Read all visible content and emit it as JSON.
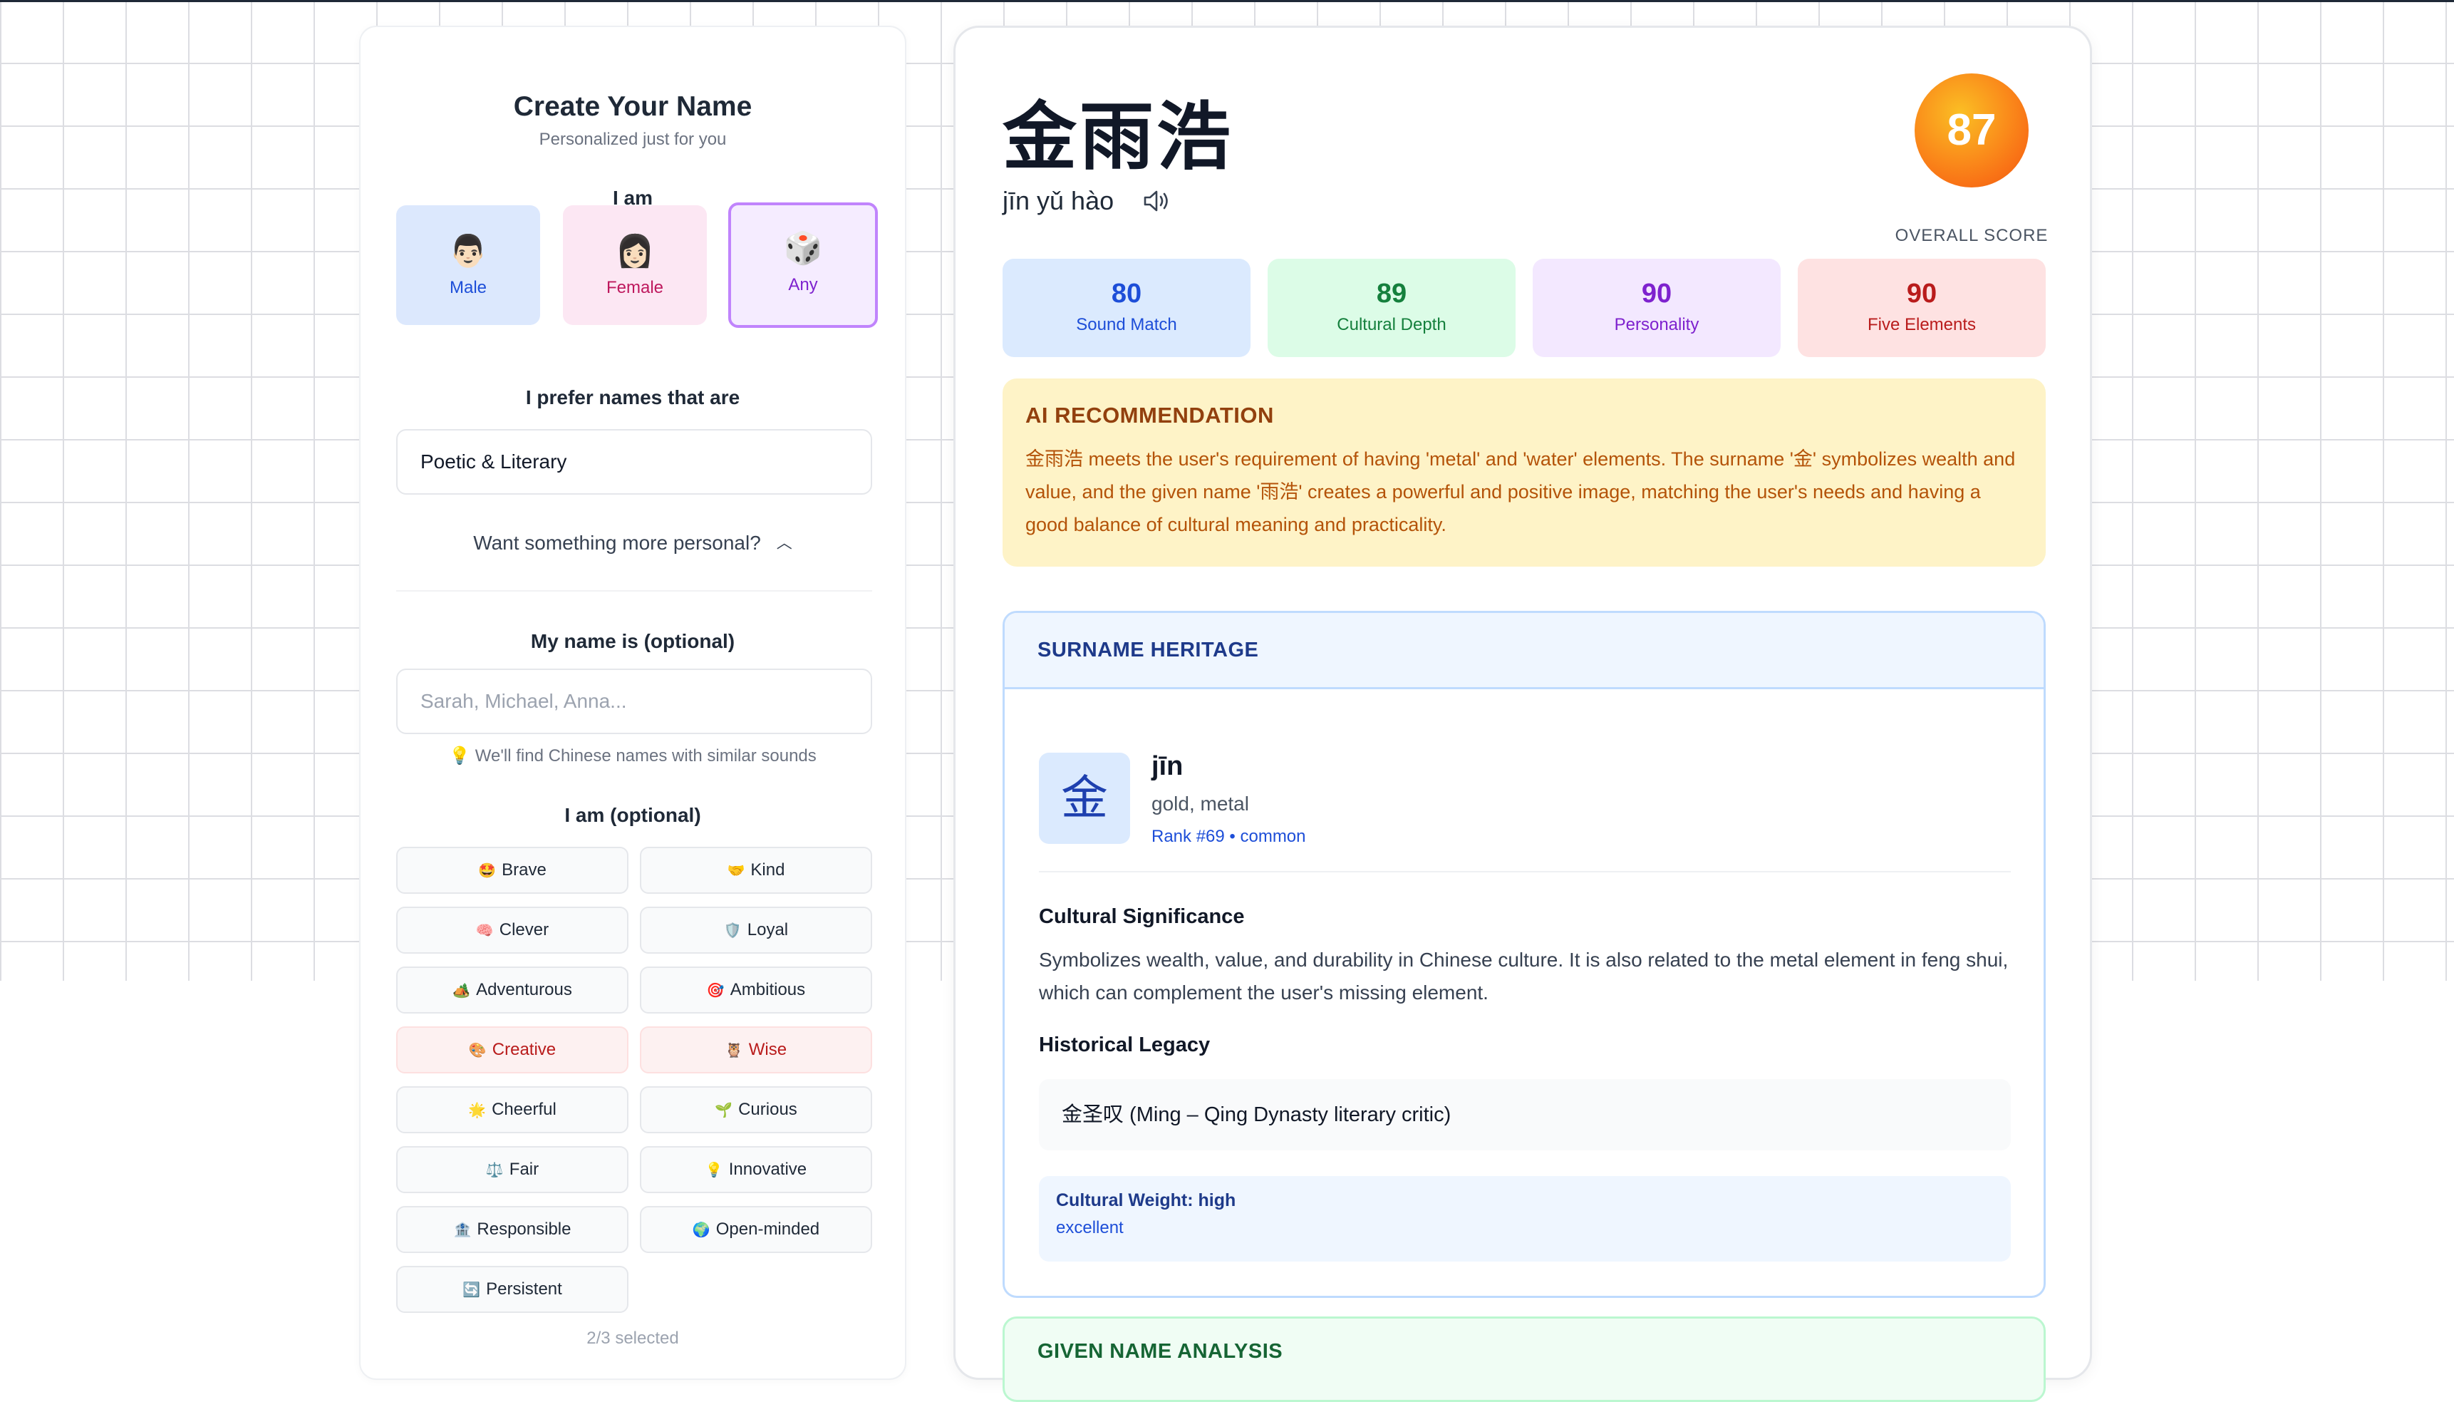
{
  "form": {
    "title": "Create Your Name",
    "subtitle": "Personalized just for you",
    "gender_label": "I am",
    "genders": [
      {
        "emoji": "👨🏻",
        "label": "Male"
      },
      {
        "emoji": "👩🏻",
        "label": "Female"
      },
      {
        "emoji": "🎲",
        "label": "Any"
      }
    ],
    "selected_gender": "Any",
    "style_label": "I prefer names that are",
    "style_value": "Poetic & Literary",
    "more_personal": "Want something more personal?",
    "my_name_label": "My name is (optional)",
    "my_name_placeholder": "Sarah, Michael, Anna...",
    "my_name_hint": "💡 We'll find Chinese names with similar sounds",
    "traits_label": "I am (optional)",
    "traits": [
      {
        "icon": "🤩",
        "label": "Brave",
        "selected": false
      },
      {
        "icon": "🤝",
        "label": "Kind",
        "selected": false
      },
      {
        "icon": "🧠",
        "label": "Clever",
        "selected": false
      },
      {
        "icon": "🛡️",
        "label": "Loyal",
        "selected": false
      },
      {
        "icon": "🏕️",
        "label": "Adventurous",
        "selected": false
      },
      {
        "icon": "🎯",
        "label": "Ambitious",
        "selected": false
      },
      {
        "icon": "🎨",
        "label": "Creative",
        "selected": true
      },
      {
        "icon": "🦉",
        "label": "Wise",
        "selected": true
      },
      {
        "icon": "🌟",
        "label": "Cheerful",
        "selected": false
      },
      {
        "icon": "🌱",
        "label": "Curious",
        "selected": false
      },
      {
        "icon": "⚖️",
        "label": "Fair",
        "selected": false
      },
      {
        "icon": "💡",
        "label": "Innovative",
        "selected": false
      },
      {
        "icon": "🏦",
        "label": "Responsible",
        "selected": false
      },
      {
        "icon": "🌍",
        "label": "Open-minded",
        "selected": false
      },
      {
        "icon": "🔄",
        "label": "Persistent",
        "selected": false
      }
    ],
    "selected_count": "2/3 selected"
  },
  "result": {
    "name": "金雨浩",
    "pinyin": "jīn yǔ hào",
    "speaker_icon": "speaker-icon",
    "overall_score": "87",
    "overall_label": "OVERALL SCORE",
    "metrics": [
      {
        "value": "80",
        "label": "Sound Match"
      },
      {
        "value": "89",
        "label": "Cultural Depth"
      },
      {
        "value": "90",
        "label": "Personality"
      },
      {
        "value": "90",
        "label": "Five Elements"
      }
    ],
    "ai_title": "AI RECOMMENDATION",
    "ai_text": "金雨浩 meets the user's requirement of having 'metal' and 'water' elements. The surname '金' symbolizes wealth and value, and the given name '雨浩' creates a powerful and positive image, matching the user's needs and having a good balance of cultural meaning and practicality.",
    "heritage": {
      "title": "SURNAME HERITAGE",
      "character": "金",
      "pinyin": "jīn",
      "meaning": "gold, metal",
      "rank": "Rank #69 • common",
      "cultural_title": "Cultural Significance",
      "cultural_text": "Symbolizes wealth, value, and durability in Chinese culture. It is also related to the metal element in feng shui, which can complement the user's missing element.",
      "legacy_title": "Historical Legacy",
      "legacy_item": "金圣叹 (Ming – Qing Dynasty literary critic)",
      "weight_title": "Cultural Weight: high",
      "weight_value": "excellent"
    },
    "given_name_title": "GIVEN NAME ANALYSIS"
  },
  "colors": {
    "score_orange": "#f97316",
    "ai_bg": "#fef3c7",
    "heritage_border": "#bfdbfe",
    "selected_trait": "#b91c1c"
  }
}
